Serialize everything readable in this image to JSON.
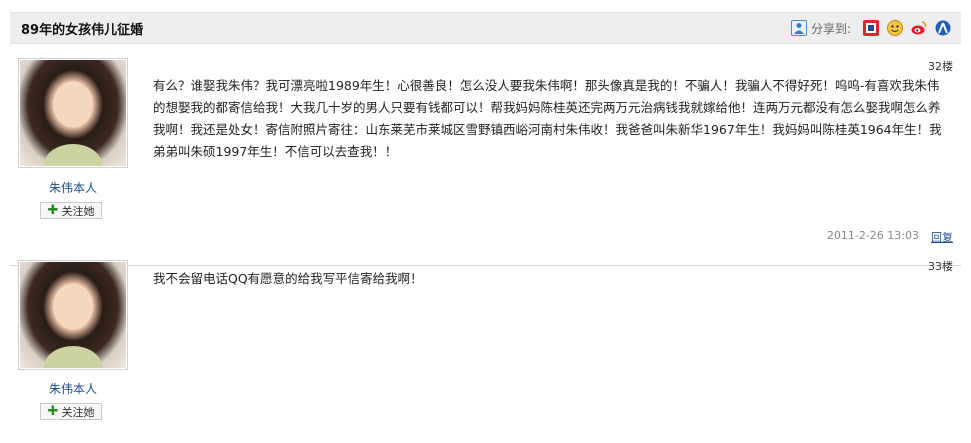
{
  "thread": {
    "title": "89年的女孩伟儿征婚"
  },
  "share": {
    "label": "分享到:",
    "icons": [
      "share-person-icon",
      "renren-icon",
      "kaixin-icon",
      "weibo-icon",
      "people-icon"
    ]
  },
  "posts": [
    {
      "floor": "32楼",
      "author": "朱伟本人",
      "follow_label": "关注她",
      "text": "有么？谁娶我朱伟？我可漂亮啦1989年生！心很善良！怎么没人要我朱伟啊！那头像真是我的！不骗人！我骗人不得好死！呜呜-有喜欢我朱伟的想娶我的都寄信给我！大我几十岁的男人只要有钱都可以！帮我妈妈陈桂英还完两万元治病钱我就嫁给他！连两万元都没有怎么娶我啊怎么养我啊！我还是处女！寄信附照片寄往：山东莱芜市莱城区雪野镇西峪河南村朱伟收！我爸爸叫朱新华1967年生！我妈妈叫陈桂英1964年生！我弟弟叫朱硕1997年生！不信可以去查我！！",
      "timestamp": "2011-2-26  13:03",
      "reply_label": "回复"
    },
    {
      "floor": "33楼",
      "author": "朱伟本人",
      "follow_label": "关注她",
      "text": "我不会留电话QQ有愿意的给我写平信寄给我啊！"
    }
  ],
  "colors": {
    "title_bar": "#ededed",
    "link": "#1d4f91",
    "follow_plus": "#2a8a2a"
  }
}
